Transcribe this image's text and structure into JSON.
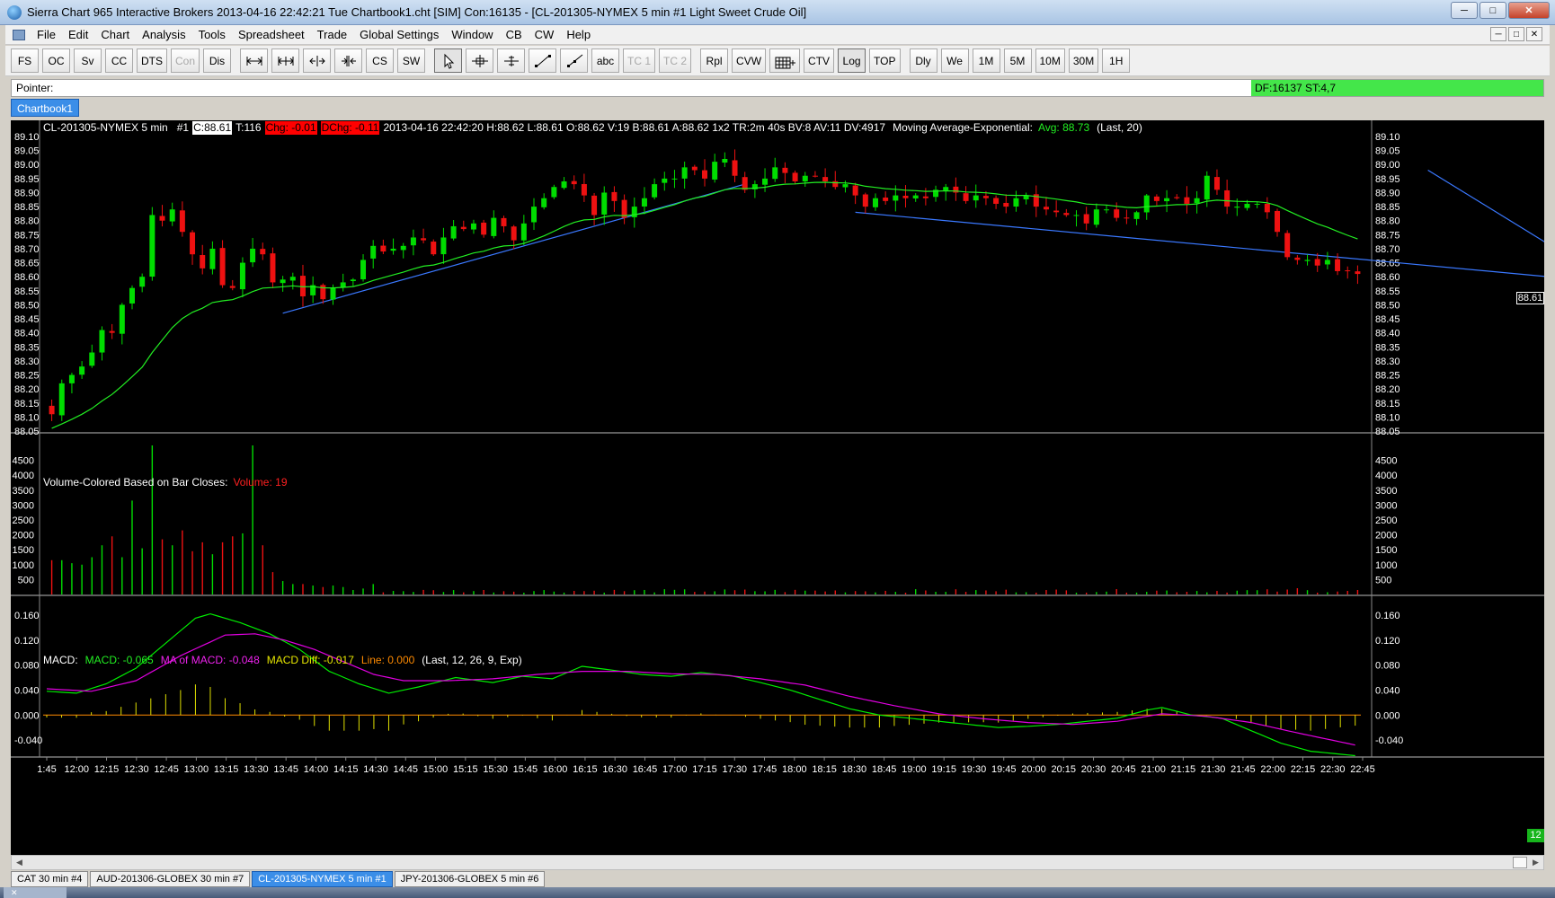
{
  "window": {
    "title": "Sierra Chart 965 Interactive Brokers 2013-04-16  22:42:21 Tue  Chartbook1.cht [SIM] Con:16135 - [CL-201305-NYMEX  5 min  #1  Light Sweet Crude Oil]",
    "minimize": "─",
    "maximize": "□",
    "close": "✕"
  },
  "menu": [
    "File",
    "Edit",
    "Chart",
    "Analysis",
    "Tools",
    "Spreadsheet",
    "Trade",
    "Global Settings",
    "Window",
    "CB",
    "CW",
    "Help"
  ],
  "toolbar": {
    "group1": [
      {
        "label": "FS",
        "disabled": false
      },
      {
        "label": "OC",
        "disabled": false
      },
      {
        "label": "Sv",
        "disabled": false
      },
      {
        "label": "CC",
        "disabled": false
      },
      {
        "label": "DTS",
        "disabled": false
      },
      {
        "label": "Con",
        "disabled": true
      },
      {
        "label": "Dis",
        "disabled": false
      }
    ],
    "group2": [
      {
        "label": "CS",
        "disabled": false
      },
      {
        "label": "SW",
        "disabled": false
      }
    ],
    "group3": [
      {
        "label": "abc",
        "disabled": false
      },
      {
        "label": "TC 1",
        "disabled": true
      },
      {
        "label": "TC 2",
        "disabled": true
      },
      {
        "label": "Rpl",
        "disabled": false
      },
      {
        "label": "CVW",
        "disabled": false
      }
    ],
    "group4": [
      {
        "label": "CTV",
        "disabled": false
      },
      {
        "label": "Log",
        "disabled": false
      },
      {
        "label": "TOP",
        "disabled": false
      },
      {
        "label": "Dly",
        "disabled": false
      },
      {
        "label": "We",
        "disabled": false
      },
      {
        "label": "1M",
        "disabled": false
      },
      {
        "label": "5M",
        "disabled": false
      },
      {
        "label": "10M",
        "disabled": false
      },
      {
        "label": "30M",
        "disabled": false
      },
      {
        "label": "1H",
        "disabled": false
      }
    ],
    "tools": [
      "move-horizontal-icon",
      "move-both-icon",
      "expand-icon",
      "compress-icon",
      "arrow-pointer-icon",
      "crosshair-icon",
      "cursor-tick-icon",
      "line-draw-icon",
      "ray-draw-icon",
      "grid-tool-icon"
    ]
  },
  "pointer": {
    "label": "Pointer:",
    "status": "DF:16137  ST:4,7"
  },
  "chartbook_tab": "Chartbook1",
  "header": {
    "symbol": "CL-201305-NYMEX  5 min",
    "id": "#1",
    "close": "C:88.61",
    "ticks": "T:116",
    "chg": "Chg: -0.01",
    "dchg": "DChg: -0.11",
    "info": "2013-04-16 22:42:20 H:88.62 L:88.61 O:88.62 V:19 B:88.61 A:88.62 1x2 TR:2m 40s BV:8 AV:11 DV:4917",
    "ma_label": "Moving Average-Exponential:",
    "ma_value": "Avg: 88.73",
    "ma_params": "(Last, 20)"
  },
  "volume_header": {
    "label": "Volume-Colored Based on Bar Closes:",
    "value": "Volume: 19"
  },
  "macd_header": {
    "label": "MACD:",
    "macd": "MACD: -0.065",
    "ma": "MA of MACD: -0.048",
    "diff": "MACD Diff: -0.017",
    "line": "Line: 0.000",
    "params": "(Last, 12, 26, 9, Exp)"
  },
  "last_price_box": "88.61",
  "bar_count_box": "12",
  "bottom_tabs": [
    {
      "label": "CAT  30 min   #4",
      "active": false
    },
    {
      "label": "AUD-201306-GLOBEX  30 min   #7",
      "active": false
    },
    {
      "label": "CL-201305-NYMEX  5 min   #1",
      "active": true
    },
    {
      "label": "JPY-201306-GLOBEX  5 min   #6",
      "active": false
    }
  ],
  "taskbar_item": "✕",
  "colors": {
    "up": "#00dd00",
    "down": "#ee1111",
    "ma": "#22ee22",
    "trend": "#3a78ff",
    "macd": "#00ee00",
    "macd_ma": "#e100e1",
    "macd_diff": "#e0e000",
    "zero": "#ff8a00"
  },
  "chart_data": [
    {
      "type": "candlestick",
      "title": "CL-201305-NYMEX  5 min",
      "ylim": [
        88.05,
        89.1
      ],
      "y_ticks": [
        "89.10",
        "89.05",
        "89.00",
        "88.95",
        "88.90",
        "88.85",
        "88.80",
        "88.75",
        "88.70",
        "88.65",
        "88.60",
        "88.55",
        "88.50",
        "88.45",
        "88.40",
        "88.35",
        "88.30",
        "88.25",
        "88.20",
        "88.15",
        "88.10",
        "88.05"
      ],
      "x_ticks": [
        "1:45",
        "12:00",
        "12:15",
        "12:30",
        "12:45",
        "13:00",
        "13:15",
        "13:30",
        "13:45",
        "14:00",
        "14:15",
        "14:30",
        "14:45",
        "15:00",
        "15:15",
        "15:30",
        "15:45",
        "16:00",
        "16:15",
        "16:30",
        "16:45",
        "17:00",
        "17:15",
        "17:30",
        "17:45",
        "18:00",
        "18:15",
        "18:30",
        "18:45",
        "19:00",
        "19:15",
        "19:30",
        "19:45",
        "20:00",
        "20:15",
        "20:30",
        "20:45",
        "21:00",
        "21:15",
        "21:30",
        "21:45",
        "22:00",
        "22:15",
        "22:30",
        "22:45"
      ],
      "closes": [
        88.11,
        88.22,
        88.25,
        88.28,
        88.33,
        88.41,
        88.4,
        88.5,
        88.56,
        88.6,
        88.82,
        88.8,
        88.84,
        88.76,
        88.68,
        88.63,
        88.7,
        88.57,
        88.56,
        88.65,
        88.7,
        88.68,
        88.58,
        88.59,
        88.6,
        88.53,
        88.57,
        88.52,
        88.56,
        88.58,
        88.59,
        88.66,
        88.71,
        88.69,
        88.7,
        88.71,
        88.74,
        88.73,
        88.68,
        88.74,
        88.78,
        88.77,
        88.79,
        88.75,
        88.81,
        88.78,
        88.73,
        88.79,
        88.85,
        88.88,
        88.92,
        88.94,
        88.93,
        88.89,
        88.82,
        88.9,
        88.87,
        88.81,
        88.85,
        88.88,
        88.93,
        88.95,
        88.95,
        88.99,
        88.98,
        88.95,
        89.01,
        89.02,
        88.96,
        88.91,
        88.93,
        88.95,
        88.99,
        88.97,
        88.94,
        88.96,
        88.96,
        88.94,
        88.92,
        88.93,
        88.89,
        88.85,
        88.88,
        88.87,
        88.89,
        88.88,
        88.89,
        88.88,
        88.91,
        88.92,
        88.9,
        88.87,
        88.89,
        88.88,
        88.86,
        88.85,
        88.88,
        88.89,
        88.85,
        88.84,
        88.83,
        88.82,
        88.82,
        88.79,
        88.84,
        88.84,
        88.81,
        88.81,
        88.83,
        88.89,
        88.87,
        88.88,
        88.88,
        88.86,
        88.88,
        88.96,
        88.91,
        88.85,
        88.85,
        88.86,
        88.86,
        88.83,
        88.76,
        88.67,
        88.66,
        88.66,
        88.64,
        88.66,
        88.62,
        88.62,
        88.61
      ],
      "ma_last": 88.73,
      "last": 88.61
    },
    {
      "type": "bar",
      "title": "Volume-Colored Based on Bar Closes",
      "ylim": [
        0,
        5000
      ],
      "y_ticks": [
        "4500",
        "4000",
        "3500",
        "3000",
        "2500",
        "2000",
        "1500",
        "1000",
        "500"
      ],
      "last": 19
    },
    {
      "type": "line",
      "title": "MACD",
      "ylim": [
        -0.06,
        0.17
      ],
      "y_ticks": [
        "0.160",
        "0.120",
        "0.080",
        "0.040",
        "0.000",
        "-0.040"
      ],
      "macd_anchors": [
        [
          0,
          0.038
        ],
        [
          4,
          0.035
        ],
        [
          8,
          0.05
        ],
        [
          12,
          0.075
        ],
        [
          16,
          0.115
        ],
        [
          20,
          0.155
        ],
        [
          22,
          0.162
        ],
        [
          26,
          0.148
        ],
        [
          30,
          0.13
        ],
        [
          34,
          0.105
        ],
        [
          38,
          0.07
        ],
        [
          42,
          0.05
        ],
        [
          46,
          0.035
        ],
        [
          50,
          0.045
        ],
        [
          55,
          0.06
        ],
        [
          60,
          0.052
        ],
        [
          64,
          0.062
        ],
        [
          68,
          0.058
        ],
        [
          72,
          0.078
        ],
        [
          76,
          0.072
        ],
        [
          80,
          0.065
        ],
        [
          84,
          0.062
        ],
        [
          88,
          0.068
        ],
        [
          92,
          0.063
        ],
        [
          96,
          0.052
        ],
        [
          100,
          0.04
        ],
        [
          104,
          0.025
        ],
        [
          108,
          0.01
        ],
        [
          112,
          0.0
        ],
        [
          116,
          -0.005
        ],
        [
          120,
          -0.01
        ],
        [
          124,
          -0.015
        ],
        [
          128,
          -0.02
        ],
        [
          132,
          -0.018
        ],
        [
          136,
          -0.015
        ],
        [
          140,
          -0.01
        ],
        [
          144,
          -0.005
        ],
        [
          148,
          0.008
        ],
        [
          150,
          0.012
        ],
        [
          154,
          0.0
        ],
        [
          158,
          -0.005
        ],
        [
          162,
          -0.025
        ],
        [
          166,
          -0.045
        ],
        [
          170,
          -0.058
        ],
        [
          176,
          -0.065
        ]
      ],
      "ma_anchors": [
        [
          0,
          0.042
        ],
        [
          6,
          0.038
        ],
        [
          12,
          0.055
        ],
        [
          18,
          0.095
        ],
        [
          24,
          0.128
        ],
        [
          28,
          0.13
        ],
        [
          32,
          0.12
        ],
        [
          36,
          0.105
        ],
        [
          40,
          0.085
        ],
        [
          44,
          0.065
        ],
        [
          48,
          0.055
        ],
        [
          54,
          0.055
        ],
        [
          60,
          0.058
        ],
        [
          66,
          0.065
        ],
        [
          72,
          0.07
        ],
        [
          78,
          0.07
        ],
        [
          84,
          0.066
        ],
        [
          90,
          0.065
        ],
        [
          96,
          0.058
        ],
        [
          102,
          0.048
        ],
        [
          108,
          0.03
        ],
        [
          114,
          0.015
        ],
        [
          120,
          0.002
        ],
        [
          126,
          -0.006
        ],
        [
          132,
          -0.012
        ],
        [
          138,
          -0.015
        ],
        [
          144,
          -0.01
        ],
        [
          150,
          0.002
        ],
        [
          156,
          -0.002
        ],
        [
          162,
          -0.012
        ],
        [
          168,
          -0.028
        ],
        [
          176,
          -0.048
        ]
      ],
      "macd_last": -0.065,
      "ma_last": -0.048,
      "diff_last": -0.017
    }
  ]
}
